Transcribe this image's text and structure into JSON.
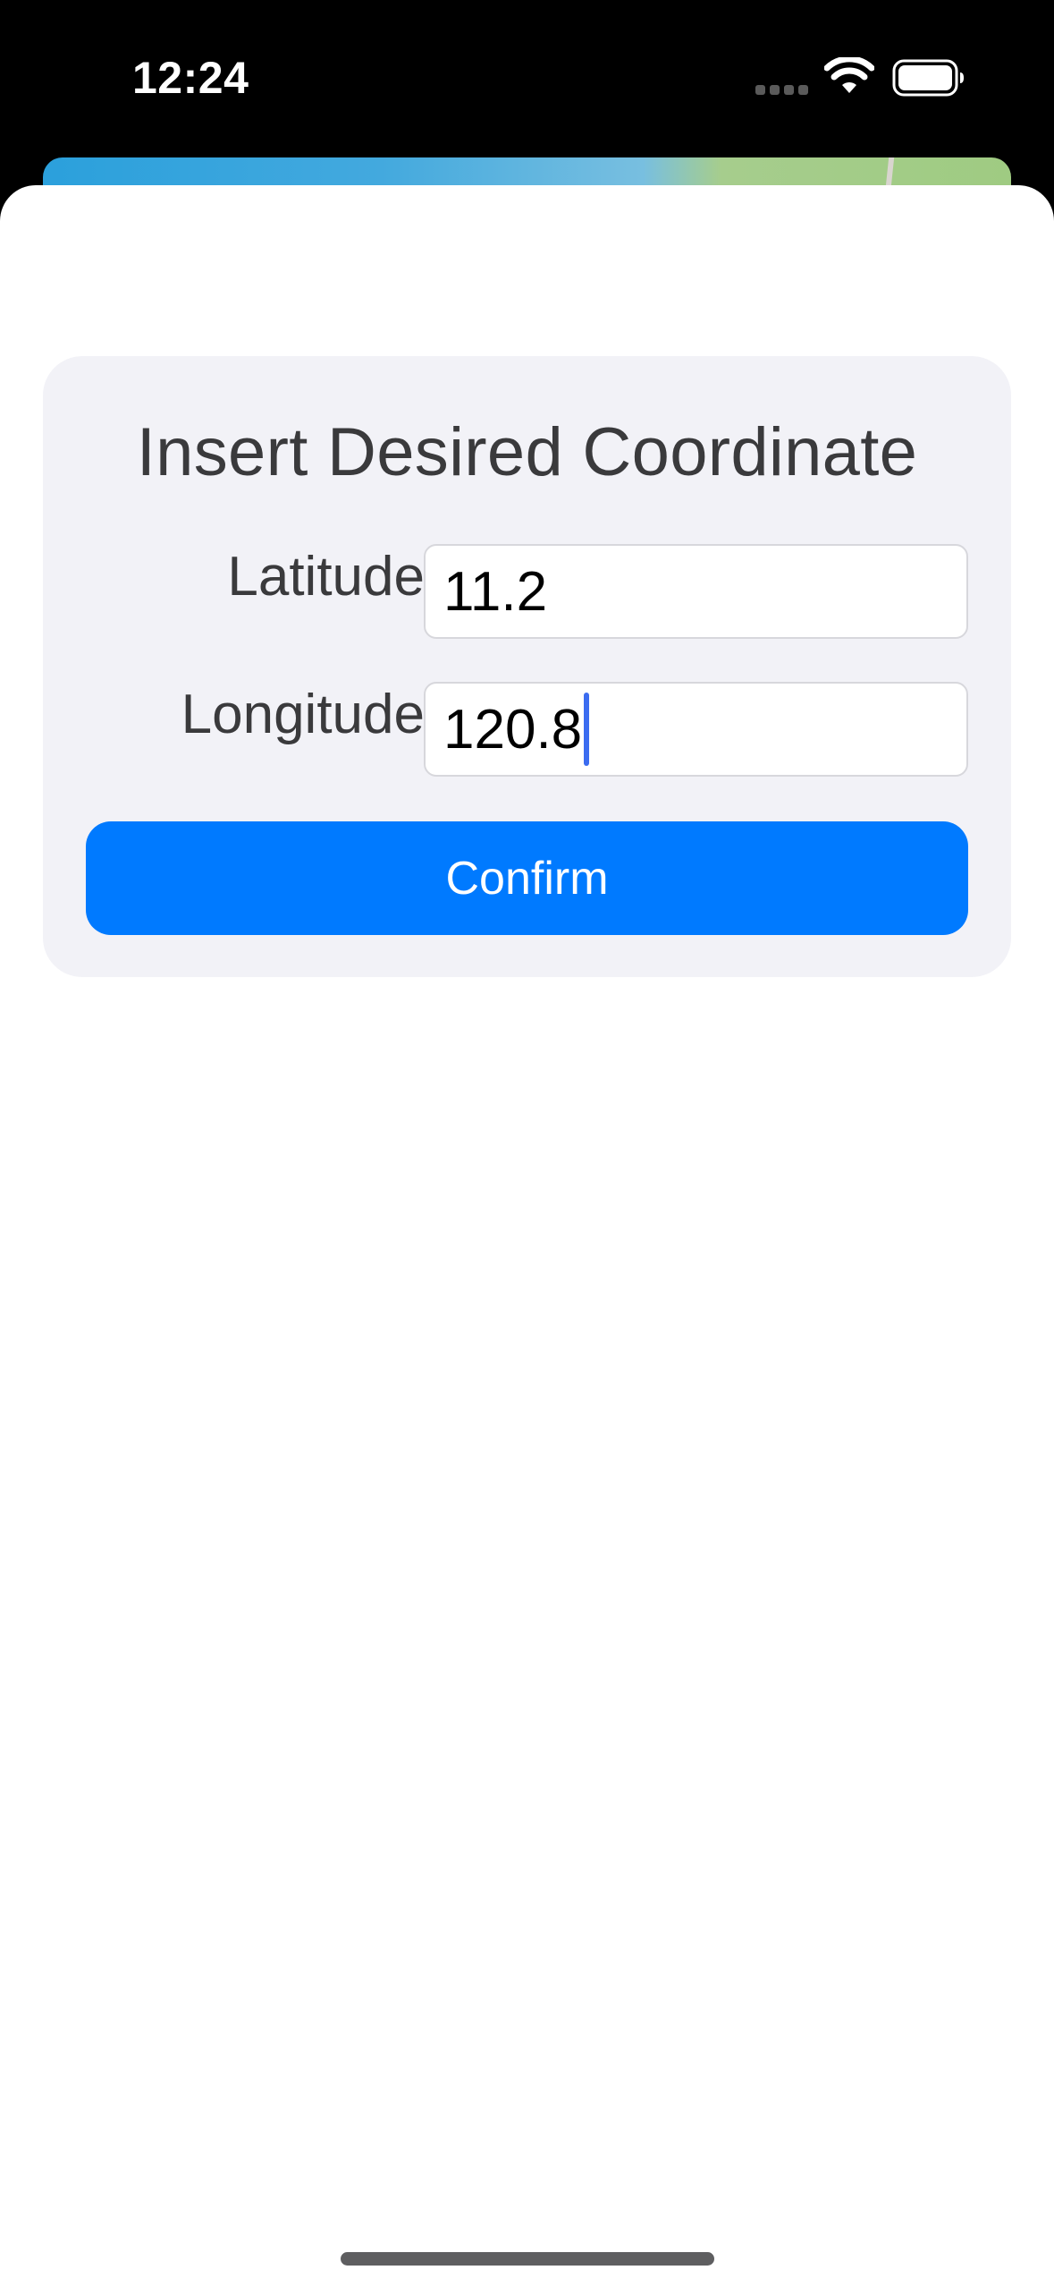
{
  "status_bar": {
    "time": "12:24",
    "icons": [
      "signal-dots-icon",
      "wifi-icon",
      "battery-icon"
    ]
  },
  "card": {
    "title": "Insert Desired Coordinate",
    "latitude": {
      "label": "Latitude",
      "value": "11.2"
    },
    "longitude": {
      "label": "Longitude",
      "value": "120.8"
    },
    "confirm_label": "Confirm"
  },
  "colors": {
    "accent": "#007aff",
    "card_background": "#f2f2f7",
    "label_text": "#3a3a3c",
    "caret": "#3b6cf0"
  }
}
